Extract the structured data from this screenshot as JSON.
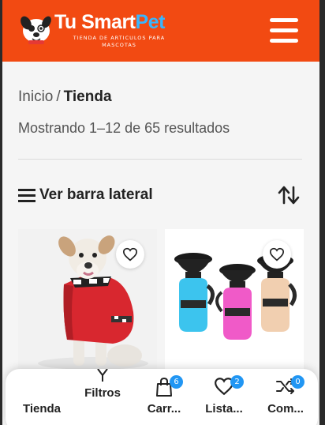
{
  "header": {
    "brand_part1": "Tu Smart",
    "brand_part2": "Pet",
    "tagline": "TIENDA DE ARTICULOS PARA MASCOTAS",
    "brand_colors": {
      "bar": "#f24a12",
      "accent": "#38b6ff"
    },
    "menu_icon": "hamburger-menu-icon"
  },
  "breadcrumb": {
    "home": "Inicio",
    "separator": "/",
    "current": "Tienda"
  },
  "results_text": "Mostrando 1–12 de 65 resultados",
  "toolbar": {
    "sidebar_label": "Ver barra lateral",
    "sidebar_icon": "hamburger-icon",
    "sort_icon": "sort-arrows-icon"
  },
  "products": [
    {
      "image": "dog-red-raincoat",
      "wishlist_icon": "heart-icon"
    },
    {
      "image": "pet-water-bottles",
      "wishlist_icon": "heart-icon"
    }
  ],
  "bottom_nav": {
    "shop": {
      "label": "Tienda",
      "icon": "shop-icon"
    },
    "filters": {
      "label": "Filtros",
      "icon": "filter-icon"
    },
    "cart": {
      "label": "Carr...",
      "icon": "shopping-bag-icon",
      "count": "6"
    },
    "wishlist": {
      "label": "Lista...",
      "icon": "heart-icon",
      "count": "2"
    },
    "compare": {
      "label": "Com...",
      "icon": "shuffle-icon",
      "count": "0"
    }
  }
}
